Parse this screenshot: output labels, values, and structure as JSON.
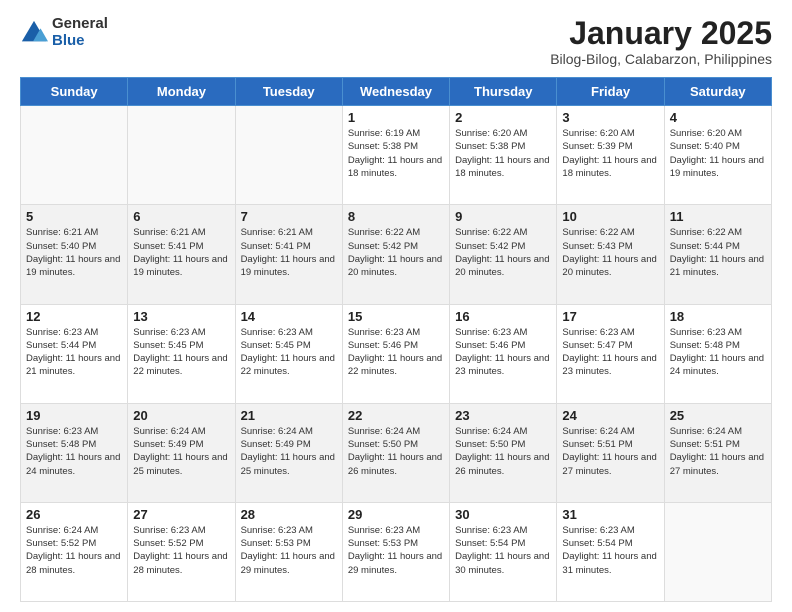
{
  "logo": {
    "general": "General",
    "blue": "Blue"
  },
  "header": {
    "month": "January 2025",
    "location": "Bilog-Bilog, Calabarzon, Philippines"
  },
  "days_of_week": [
    "Sunday",
    "Monday",
    "Tuesday",
    "Wednesday",
    "Thursday",
    "Friday",
    "Saturday"
  ],
  "weeks": [
    [
      {
        "day": "",
        "info": ""
      },
      {
        "day": "",
        "info": ""
      },
      {
        "day": "",
        "info": ""
      },
      {
        "day": "1",
        "info": "Sunrise: 6:19 AM\nSunset: 5:38 PM\nDaylight: 11 hours and 18 minutes."
      },
      {
        "day": "2",
        "info": "Sunrise: 6:20 AM\nSunset: 5:38 PM\nDaylight: 11 hours and 18 minutes."
      },
      {
        "day": "3",
        "info": "Sunrise: 6:20 AM\nSunset: 5:39 PM\nDaylight: 11 hours and 18 minutes."
      },
      {
        "day": "4",
        "info": "Sunrise: 6:20 AM\nSunset: 5:40 PM\nDaylight: 11 hours and 19 minutes."
      }
    ],
    [
      {
        "day": "5",
        "info": "Sunrise: 6:21 AM\nSunset: 5:40 PM\nDaylight: 11 hours and 19 minutes."
      },
      {
        "day": "6",
        "info": "Sunrise: 6:21 AM\nSunset: 5:41 PM\nDaylight: 11 hours and 19 minutes."
      },
      {
        "day": "7",
        "info": "Sunrise: 6:21 AM\nSunset: 5:41 PM\nDaylight: 11 hours and 19 minutes."
      },
      {
        "day": "8",
        "info": "Sunrise: 6:22 AM\nSunset: 5:42 PM\nDaylight: 11 hours and 20 minutes."
      },
      {
        "day": "9",
        "info": "Sunrise: 6:22 AM\nSunset: 5:42 PM\nDaylight: 11 hours and 20 minutes."
      },
      {
        "day": "10",
        "info": "Sunrise: 6:22 AM\nSunset: 5:43 PM\nDaylight: 11 hours and 20 minutes."
      },
      {
        "day": "11",
        "info": "Sunrise: 6:22 AM\nSunset: 5:44 PM\nDaylight: 11 hours and 21 minutes."
      }
    ],
    [
      {
        "day": "12",
        "info": "Sunrise: 6:23 AM\nSunset: 5:44 PM\nDaylight: 11 hours and 21 minutes."
      },
      {
        "day": "13",
        "info": "Sunrise: 6:23 AM\nSunset: 5:45 PM\nDaylight: 11 hours and 22 minutes."
      },
      {
        "day": "14",
        "info": "Sunrise: 6:23 AM\nSunset: 5:45 PM\nDaylight: 11 hours and 22 minutes."
      },
      {
        "day": "15",
        "info": "Sunrise: 6:23 AM\nSunset: 5:46 PM\nDaylight: 11 hours and 22 minutes."
      },
      {
        "day": "16",
        "info": "Sunrise: 6:23 AM\nSunset: 5:46 PM\nDaylight: 11 hours and 23 minutes."
      },
      {
        "day": "17",
        "info": "Sunrise: 6:23 AM\nSunset: 5:47 PM\nDaylight: 11 hours and 23 minutes."
      },
      {
        "day": "18",
        "info": "Sunrise: 6:23 AM\nSunset: 5:48 PM\nDaylight: 11 hours and 24 minutes."
      }
    ],
    [
      {
        "day": "19",
        "info": "Sunrise: 6:23 AM\nSunset: 5:48 PM\nDaylight: 11 hours and 24 minutes."
      },
      {
        "day": "20",
        "info": "Sunrise: 6:24 AM\nSunset: 5:49 PM\nDaylight: 11 hours and 25 minutes."
      },
      {
        "day": "21",
        "info": "Sunrise: 6:24 AM\nSunset: 5:49 PM\nDaylight: 11 hours and 25 minutes."
      },
      {
        "day": "22",
        "info": "Sunrise: 6:24 AM\nSunset: 5:50 PM\nDaylight: 11 hours and 26 minutes."
      },
      {
        "day": "23",
        "info": "Sunrise: 6:24 AM\nSunset: 5:50 PM\nDaylight: 11 hours and 26 minutes."
      },
      {
        "day": "24",
        "info": "Sunrise: 6:24 AM\nSunset: 5:51 PM\nDaylight: 11 hours and 27 minutes."
      },
      {
        "day": "25",
        "info": "Sunrise: 6:24 AM\nSunset: 5:51 PM\nDaylight: 11 hours and 27 minutes."
      }
    ],
    [
      {
        "day": "26",
        "info": "Sunrise: 6:24 AM\nSunset: 5:52 PM\nDaylight: 11 hours and 28 minutes."
      },
      {
        "day": "27",
        "info": "Sunrise: 6:23 AM\nSunset: 5:52 PM\nDaylight: 11 hours and 28 minutes."
      },
      {
        "day": "28",
        "info": "Sunrise: 6:23 AM\nSunset: 5:53 PM\nDaylight: 11 hours and 29 minutes."
      },
      {
        "day": "29",
        "info": "Sunrise: 6:23 AM\nSunset: 5:53 PM\nDaylight: 11 hours and 29 minutes."
      },
      {
        "day": "30",
        "info": "Sunrise: 6:23 AM\nSunset: 5:54 PM\nDaylight: 11 hours and 30 minutes."
      },
      {
        "day": "31",
        "info": "Sunrise: 6:23 AM\nSunset: 5:54 PM\nDaylight: 11 hours and 31 minutes."
      },
      {
        "day": "",
        "info": ""
      }
    ]
  ]
}
